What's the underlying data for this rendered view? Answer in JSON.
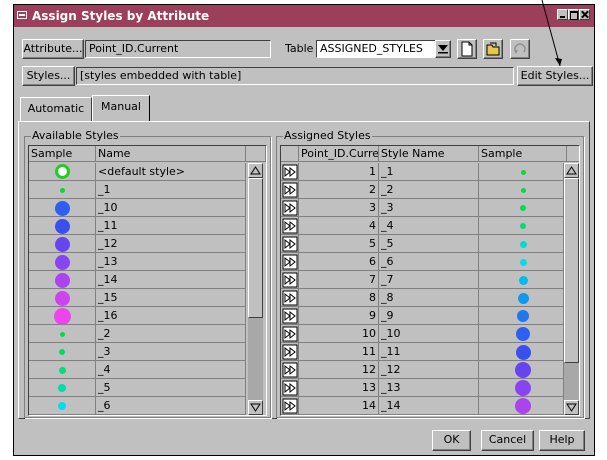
{
  "window": {
    "title": "Assign Styles by Attribute"
  },
  "attribute": {
    "button_label": "Attribute...",
    "value": "Point_ID.Current"
  },
  "table_select": {
    "label": "Table",
    "value": "ASSIGNED_STYLES"
  },
  "styles": {
    "button_label": "Styles...",
    "value": "[styles embedded with table]",
    "edit_button_label": "Edit Styles..."
  },
  "tabs": [
    {
      "label": "Automatic"
    },
    {
      "label": "Manual"
    }
  ],
  "available_styles": {
    "title": "Available Styles",
    "columns": [
      "Sample",
      "Name"
    ],
    "rows": [
      {
        "name": "<default style>",
        "color": "#22cc22",
        "kind": "default"
      },
      {
        "name": "_1",
        "color": "#00dd33",
        "size": 5
      },
      {
        "name": "_10",
        "color": "#2e5ff0",
        "size": 15
      },
      {
        "name": "_11",
        "color": "#3a50ee",
        "size": 15
      },
      {
        "name": "_12",
        "color": "#6644ee",
        "size": 15
      },
      {
        "name": "_13",
        "color": "#8844ee",
        "size": 15
      },
      {
        "name": "_14",
        "color": "#aa44ee",
        "size": 15
      },
      {
        "name": "_15",
        "color": "#cc44ee",
        "size": 15
      },
      {
        "name": "_16",
        "color": "#ee44ee",
        "size": 17
      },
      {
        "name": "_2",
        "color": "#00dd44",
        "size": 5
      },
      {
        "name": "_3",
        "color": "#00dd55",
        "size": 6
      },
      {
        "name": "_4",
        "color": "#00dd77",
        "size": 7
      },
      {
        "name": "_5",
        "color": "#00ddaa",
        "size": 8
      },
      {
        "name": "_6",
        "color": "#00ddee",
        "size": 8
      }
    ]
  },
  "assigned_styles": {
    "title": "Assigned Styles",
    "columns": [
      "Point_ID.Current",
      "Style Name",
      "Sample"
    ],
    "rows": [
      {
        "id": "1",
        "style": "_1",
        "color": "#00dd33",
        "size": 5
      },
      {
        "id": "2",
        "style": "_2",
        "color": "#00dd44",
        "size": 5
      },
      {
        "id": "3",
        "style": "_3",
        "color": "#00dd55",
        "size": 6
      },
      {
        "id": "4",
        "style": "_4",
        "color": "#00dd77",
        "size": 6
      },
      {
        "id": "5",
        "style": "_5",
        "color": "#00ddcc",
        "size": 7
      },
      {
        "id": "6",
        "style": "_6",
        "color": "#00ddee",
        "size": 7
      },
      {
        "id": "7",
        "style": "_7",
        "color": "#00bbee",
        "size": 9
      },
      {
        "id": "8",
        "style": "_8",
        "color": "#1199ee",
        "size": 11
      },
      {
        "id": "9",
        "style": "_9",
        "color": "#2277ee",
        "size": 12
      },
      {
        "id": "10",
        "style": "_10",
        "color": "#2e5ff0",
        "size": 14
      },
      {
        "id": "11",
        "style": "_11",
        "color": "#3a50ee",
        "size": 15
      },
      {
        "id": "12",
        "style": "_12",
        "color": "#6644ee",
        "size": 16
      },
      {
        "id": "13",
        "style": "_13",
        "color": "#8844ee",
        "size": 16
      },
      {
        "id": "14",
        "style": "_14",
        "color": "#aa44ee",
        "size": 16
      }
    ]
  },
  "footer": {
    "ok_label": "OK",
    "cancel_label": "Cancel",
    "help_label": "Help"
  }
}
